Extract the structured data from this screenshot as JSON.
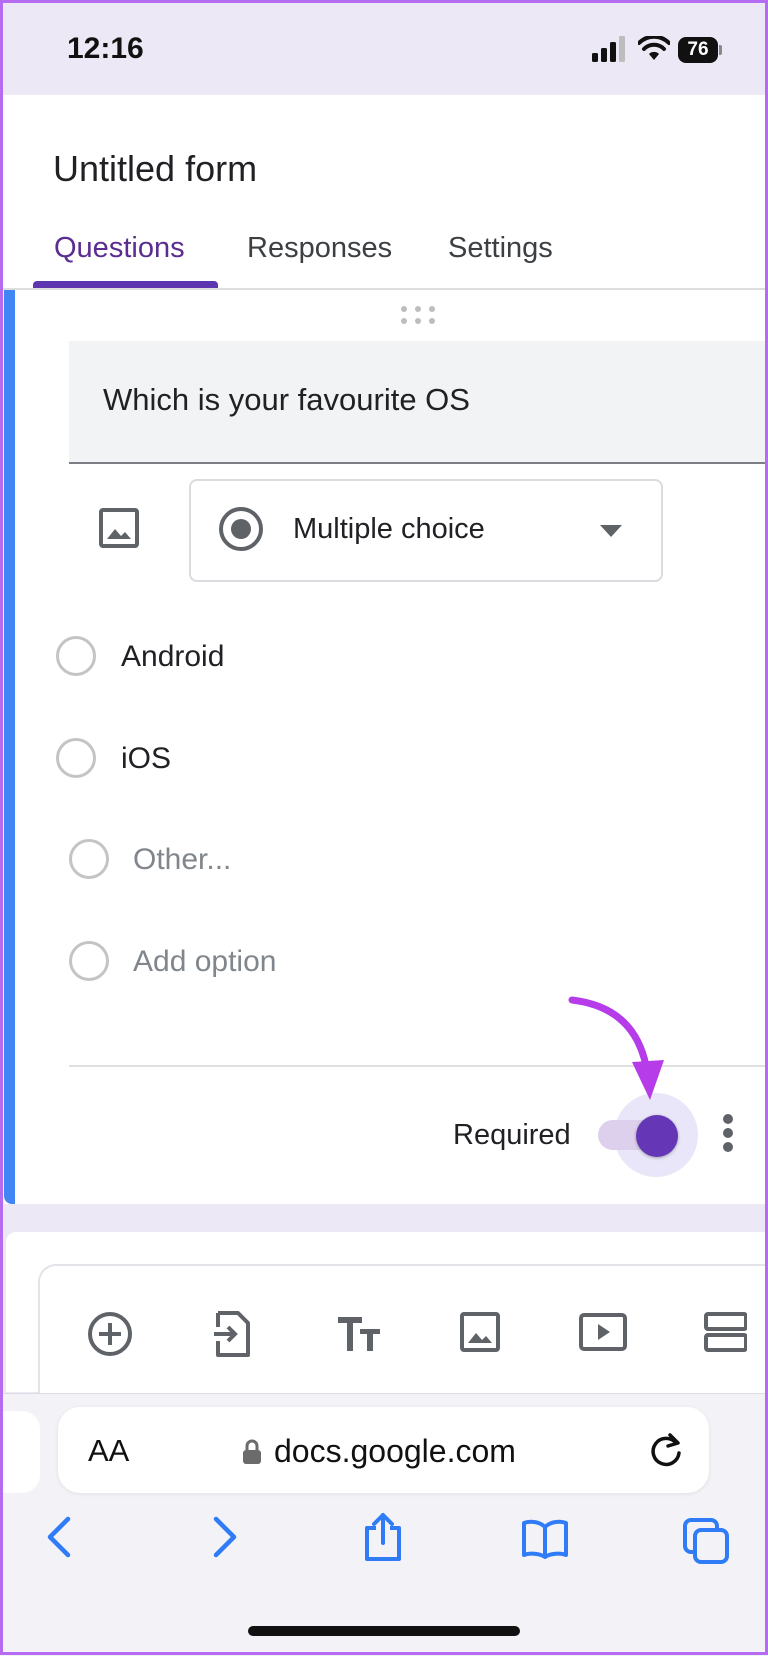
{
  "status_bar": {
    "time": "12:16",
    "battery": "76"
  },
  "form": {
    "title": "Untitled form",
    "tabs": [
      {
        "label": "Questions",
        "active": true
      },
      {
        "label": "Responses",
        "active": false
      },
      {
        "label": "Settings",
        "active": false
      }
    ]
  },
  "question": {
    "text": "Which is your favourite OS",
    "type": "Multiple choice",
    "options": [
      {
        "label": "Android"
      },
      {
        "label": "iOS"
      },
      {
        "label": "Other..."
      },
      {
        "label": "Add option"
      }
    ],
    "required_label": "Required",
    "required": true
  },
  "toolbar": {
    "items": [
      "add-question-icon",
      "import-questions-icon",
      "add-title-icon",
      "add-image-icon",
      "add-video-icon",
      "add-section-icon"
    ]
  },
  "browser": {
    "text_size_label": "AA",
    "url": "docs.google.com"
  },
  "colors": {
    "accent": "#5e35b1",
    "card_accent": "#4285f4",
    "annotation_arrow": "#b53ce8"
  }
}
